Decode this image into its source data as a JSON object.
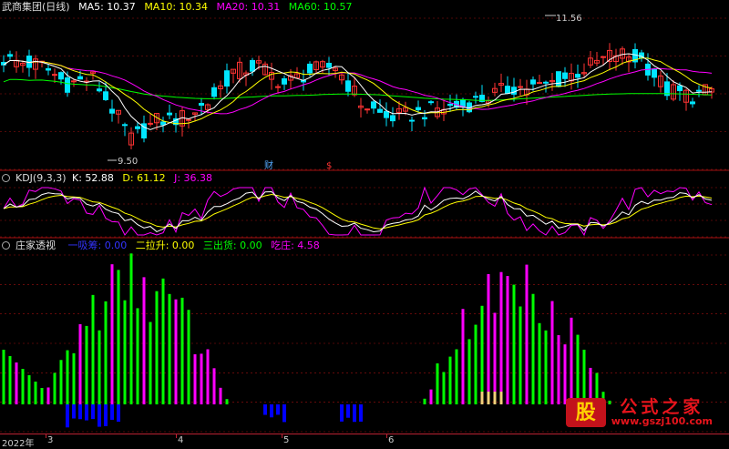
{
  "colors": {
    "up": "#ff3333",
    "down": "#00e5ff",
    "ma5": "#ffffff",
    "ma10": "#ffff00",
    "ma20": "#ff00ff",
    "ma60": "#00ff00",
    "k": "#ffffff",
    "d": "#ffff00",
    "j": "#ff00ff",
    "ttl": "#00ff00",
    "dxg": "#0000ff",
    "elevate": "#ffff00",
    "exitc": "#00ff00",
    "spot": "#ff00ff",
    "grid": "#a01010",
    "divider": "#a01010",
    "axis": "#b52222"
  },
  "main": {
    "title": "武商集团(日线)",
    "ma5_label": "MA5: 10.37",
    "ma10_label": "MA10: 10.34",
    "ma20_label": "MA20: 10.31",
    "ma60_label": "MA60: 10.57",
    "high_label": "11.56",
    "low_label": "9.50",
    "marker1": "财",
    "marker2": "$"
  },
  "kdj": {
    "title": "KDJ(9,3,3)",
    "k_label": "K: 52.88",
    "d_label": "D: 61.12",
    "j_label": "J: 36.38"
  },
  "zj": {
    "title": "庄家透视",
    "dxg_label": "一吸筹: 0.00",
    "elevate_label": "二拉升: 0.00",
    "exit_label": "三出货: 0.00",
    "spot_label": "吃庄: 4.58"
  },
  "xaxis": {
    "year": "2022年",
    "m3": "3",
    "m4": "4",
    "m5": "5",
    "m6": "6"
  },
  "watermark": {
    "logo": "股",
    "name": "公式之家",
    "url": "www.gszj100.com"
  },
  "chart_data": {
    "type": "candlestick",
    "title": "武商集团(日线)",
    "price_range": [
      9.5,
      11.56
    ],
    "annotations": [
      "11.56",
      "9.50",
      "财",
      "$"
    ],
    "kdj": {
      "K": 52.88,
      "D": 61.12,
      "J": 36.38
    },
    "zj": {
      "一吸筹": 0.0,
      "二拉升": 0.0,
      "三出货": 0.0,
      "吃庄": 4.58
    },
    "x_ticks": [
      "2022年",
      "3",
      "4",
      "5",
      "6"
    ]
  }
}
